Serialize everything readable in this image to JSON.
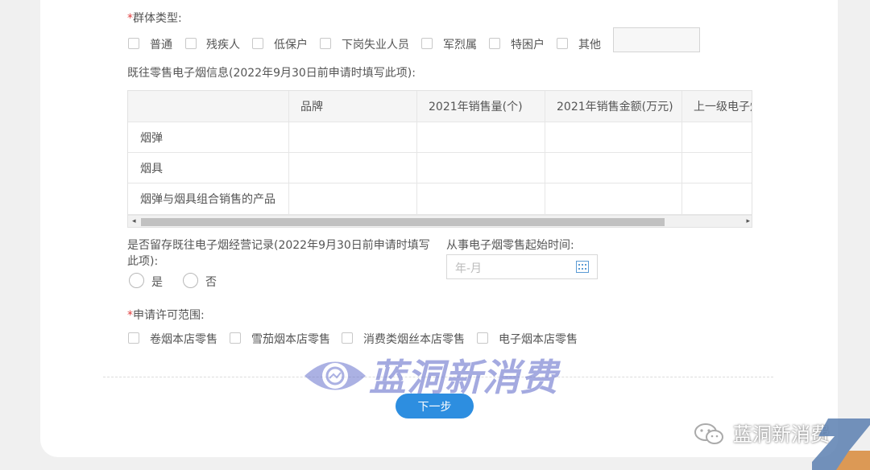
{
  "group_type": {
    "required_mark": "*",
    "label": "群体类型:",
    "options": [
      "普通",
      "残疾人",
      "低保户",
      "下岗失业人员",
      "军烈属",
      "特困户",
      "其他"
    ],
    "other_input_value": ""
  },
  "past_sales": {
    "label": "既往零售电子烟信息(2022年9月30日前申请时填写此项):",
    "columns": [
      "",
      "品牌",
      "2021年销售量(个)",
      "2021年销售金额(万元)",
      "上一级电子烟"
    ],
    "rows": [
      "烟弹",
      "烟具",
      "烟弹与烟具组合销售的产品"
    ],
    "scroll_left": "◂",
    "scroll_right": "▸"
  },
  "retain_records": {
    "label_line1": "是否留存既往电子烟经营记录(2022年9月30日前申请时填写",
    "label_line2": "此项):",
    "options": [
      "是",
      "否"
    ]
  },
  "start_time": {
    "label": "从事电子烟零售起始时间:",
    "placeholder": "年-月"
  },
  "license_scope": {
    "required_mark": "*",
    "label": "申请许可范围:",
    "options": [
      "卷烟本店零售",
      "雪茄烟本店零售",
      "消费类烟丝本店零售",
      "电子烟本店零售"
    ]
  },
  "next_button": "下一步",
  "watermark": {
    "text": "蓝洞新消费",
    "wechat_text": "蓝洞新消费"
  },
  "colors": {
    "accent": "#2d8ee0",
    "required": "#e03c3c",
    "watermark": "#5a66c8"
  }
}
